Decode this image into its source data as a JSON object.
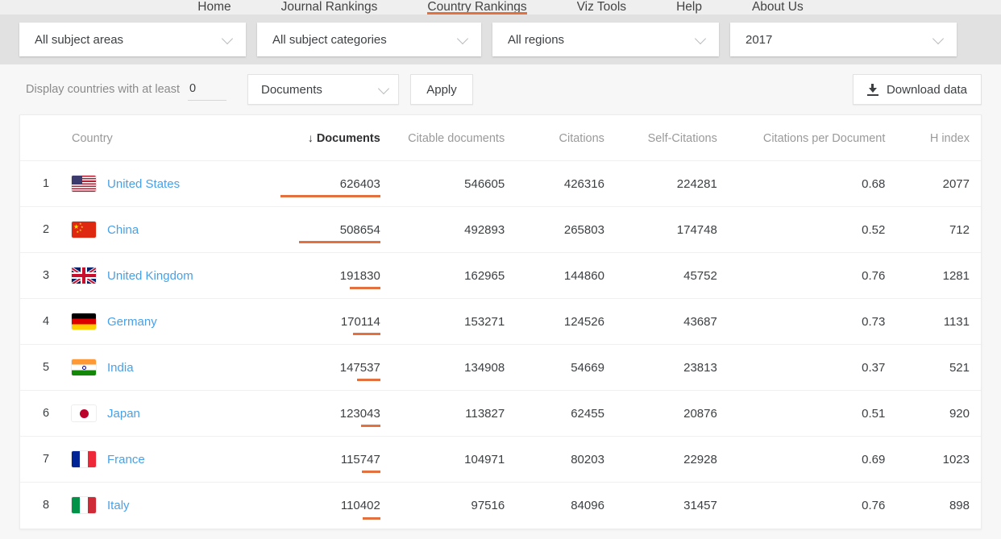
{
  "nav": {
    "items": [
      {
        "label": "Home",
        "active": false
      },
      {
        "label": "Journal Rankings",
        "active": false
      },
      {
        "label": "Country Rankings",
        "active": true
      },
      {
        "label": "Viz Tools",
        "active": false
      },
      {
        "label": "Help",
        "active": false
      },
      {
        "label": "About Us",
        "active": false
      }
    ]
  },
  "filters": {
    "subject_area": "All subject areas",
    "subject_category": "All subject categories",
    "region": "All regions",
    "year": "2017"
  },
  "toolbar": {
    "threshold_label": "Display countries with at least",
    "threshold_value": "0",
    "threshold_placeholder": "0",
    "metric": "Documents",
    "apply_label": "Apply",
    "download_label": "Download data",
    "download_icon": "download-icon"
  },
  "table": {
    "columns": [
      {
        "key": "rank",
        "label": ""
      },
      {
        "key": "country",
        "label": "Country"
      },
      {
        "key": "documents",
        "label": "Documents",
        "sorted": true,
        "sort_arrow": "↓"
      },
      {
        "key": "citable",
        "label": "Citable documents"
      },
      {
        "key": "citations",
        "label": "Citations"
      },
      {
        "key": "self_citations",
        "label": "Self-Citations"
      },
      {
        "key": "cpd",
        "label": "Citations per Document"
      },
      {
        "key": "h_index",
        "label": "H index"
      }
    ],
    "bar_color": "#e3703f",
    "bar_max_width": 124,
    "rows": [
      {
        "rank": "1",
        "country": "United States",
        "flag": "us",
        "documents": "626403",
        "documents_num": 626403,
        "citable": "546605",
        "citations": "426316",
        "self_citations": "224281",
        "cpd": "0.68",
        "h_index": "2077"
      },
      {
        "rank": "2",
        "country": "China",
        "flag": "cn",
        "documents": "508654",
        "documents_num": 508654,
        "citable": "492893",
        "citations": "265803",
        "self_citations": "174748",
        "cpd": "0.52",
        "h_index": "712"
      },
      {
        "rank": "3",
        "country": "United Kingdom",
        "flag": "gb",
        "documents": "191830",
        "documents_num": 191830,
        "citable": "162965",
        "citations": "144860",
        "self_citations": "45752",
        "cpd": "0.76",
        "h_index": "1281"
      },
      {
        "rank": "4",
        "country": "Germany",
        "flag": "de",
        "documents": "170114",
        "documents_num": 170114,
        "citable": "153271",
        "citations": "124526",
        "self_citations": "43687",
        "cpd": "0.73",
        "h_index": "1131"
      },
      {
        "rank": "5",
        "country": "India",
        "flag": "in",
        "documents": "147537",
        "documents_num": 147537,
        "citable": "134908",
        "citations": "54669",
        "self_citations": "23813",
        "cpd": "0.37",
        "h_index": "521"
      },
      {
        "rank": "6",
        "country": "Japan",
        "flag": "jp",
        "documents": "123043",
        "documents_num": 123043,
        "citable": "113827",
        "citations": "62455",
        "self_citations": "20876",
        "cpd": "0.51",
        "h_index": "920"
      },
      {
        "rank": "7",
        "country": "France",
        "flag": "fr",
        "documents": "115747",
        "documents_num": 115747,
        "citable": "104971",
        "citations": "80203",
        "self_citations": "22928",
        "cpd": "0.69",
        "h_index": "1023"
      },
      {
        "rank": "8",
        "country": "Italy",
        "flag": "it",
        "documents": "110402",
        "documents_num": 110402,
        "citable": "97516",
        "citations": "84096",
        "self_citations": "31457",
        "cpd": "0.76",
        "h_index": "898"
      }
    ]
  }
}
